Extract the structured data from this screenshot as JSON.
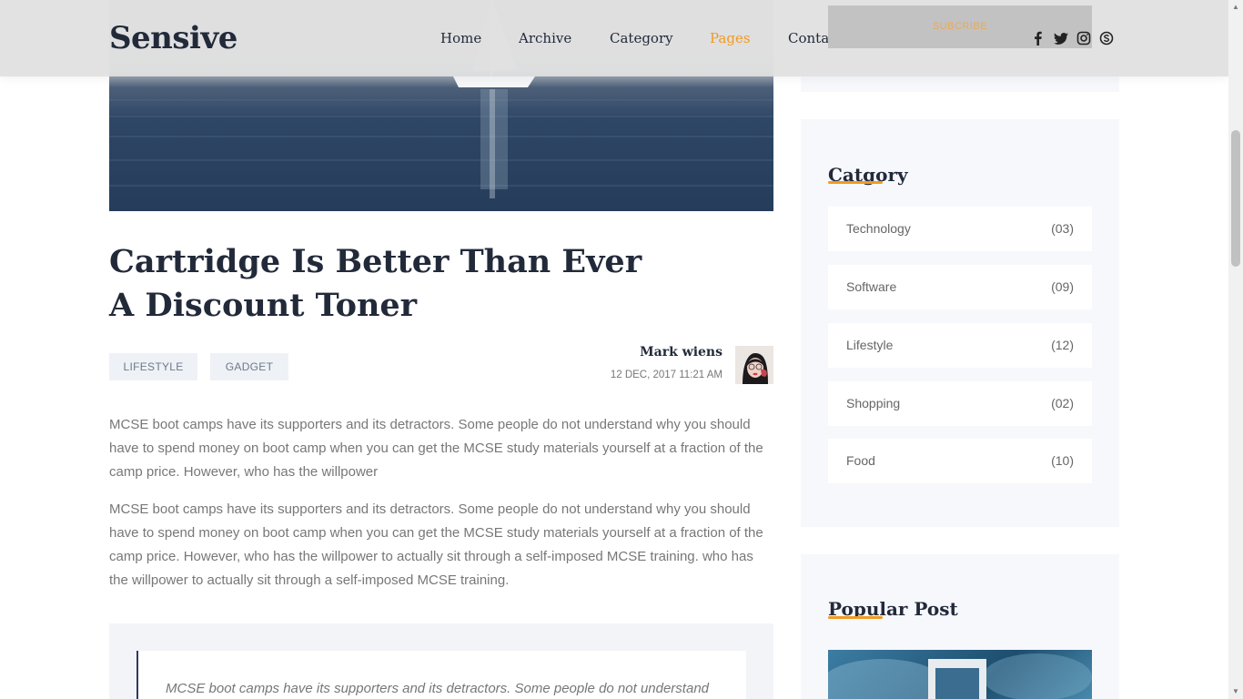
{
  "header": {
    "logo": "Sensive",
    "nav": [
      {
        "label": "Home",
        "active": false
      },
      {
        "label": "Archive",
        "active": false
      },
      {
        "label": "Category",
        "active": false
      },
      {
        "label": "Pages",
        "active": true
      },
      {
        "label": "Contact",
        "active": false
      }
    ],
    "subscribe_label": "SUBCRIBE",
    "social_icons": [
      "facebook-icon",
      "twitter-icon",
      "instagram-icon",
      "skype-icon"
    ]
  },
  "article": {
    "title_line1": "Cartridge Is Better Than Ever",
    "title_line2": "A Discount Toner",
    "tags": [
      "LIFESTYLE",
      "GADGET"
    ],
    "author": "Mark wiens",
    "date": "12 DEC, 2017 11:21 AM",
    "paragraph1": "MCSE boot camps have its supporters and its detractors. Some people do not understand why you should have to spend money on boot camp when you can get the MCSE study materials yourself at a fraction of the camp price. However, who has the willpower",
    "paragraph2": "MCSE boot camps have its supporters and its detractors. Some people do not understand why you should have to spend money on boot camp when you can get the MCSE study materials yourself at a fraction of the camp price. However, who has the willpower to actually sit through a self-imposed MCSE training. who has the willpower to actually sit through a self-imposed MCSE training.",
    "quote": "MCSE boot camps have its supporters and its detractors. Some people do not understand"
  },
  "sidebar": {
    "category": {
      "title": "Catgory",
      "items": [
        {
          "name": "Technology",
          "count": "(03)"
        },
        {
          "name": "Software",
          "count": "(09)"
        },
        {
          "name": "Lifestyle",
          "count": "(12)"
        },
        {
          "name": "Shopping",
          "count": "(02)"
        },
        {
          "name": "Food",
          "count": "(10)"
        }
      ]
    },
    "popular": {
      "title": "Popular Post"
    }
  },
  "colors": {
    "accent": "#f09b22",
    "heading": "#222a3a",
    "body_text": "#777777",
    "widget_bg": "#f7f8fc"
  }
}
